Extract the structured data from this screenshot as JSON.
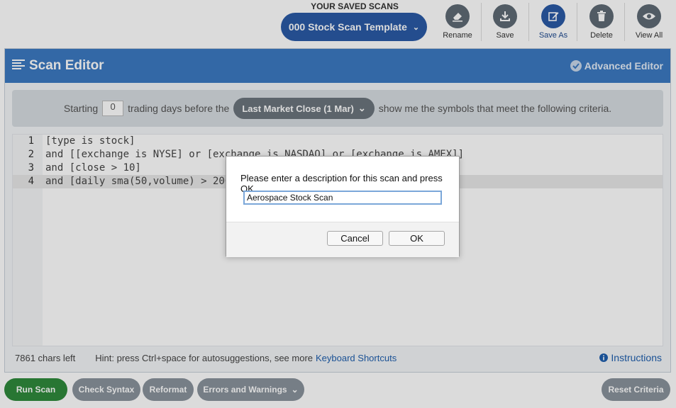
{
  "header": {
    "saved_scans_label": "YOUR SAVED SCANS",
    "template_name": "000 Stock Scan Template",
    "tools": [
      {
        "label": "Rename",
        "icon": "eraser-icon"
      },
      {
        "label": "Save",
        "icon": "download-icon"
      },
      {
        "label": "Save As",
        "icon": "edit-icon"
      },
      {
        "label": "Delete",
        "icon": "trash-icon"
      },
      {
        "label": "View All",
        "icon": "eye-icon"
      }
    ]
  },
  "editor": {
    "title": "Scan Editor",
    "advanced_label": "Advanced Editor",
    "criteria": {
      "prefix": "Starting",
      "days": "0",
      "middle": "trading days before the",
      "market_close": "Last Market Close (1 Mar)",
      "suffix": "show me the symbols that meet the following criteria."
    },
    "code_lines": [
      {
        "n": "1",
        "text": "[type is stock]"
      },
      {
        "n": "2",
        "text": "and [[exchange is NYSE] or [exchange is NASDAQ] or [exchange is AMEX]]"
      },
      {
        "n": "3",
        "text": "and [close > 10]"
      },
      {
        "n": "4",
        "text": "and [daily sma(50,volume) > 200"
      }
    ],
    "chars_left": "7861 chars left",
    "hint": "Hint: press Ctrl+space for autosuggestions, see more",
    "shortcuts_link": "Keyboard Shortcuts",
    "instructions_label": "Instructions"
  },
  "buttons": {
    "run_scan": "Run Scan",
    "check_syntax": "Check Syntax",
    "reformat": "Reformat",
    "errors_warnings": "Errors and Warnings",
    "reset_criteria": "Reset Criteria"
  },
  "dialog": {
    "message": "Please enter a description for this scan and press OK.",
    "input_value": "Aerospace Stock Scan",
    "cancel": "Cancel",
    "ok": "OK"
  },
  "colors": {
    "primary": "#3c7ac2",
    "button_blue": "#2b5aa6",
    "run_green": "#2f8a3c",
    "gray_button": "#8a939c"
  }
}
